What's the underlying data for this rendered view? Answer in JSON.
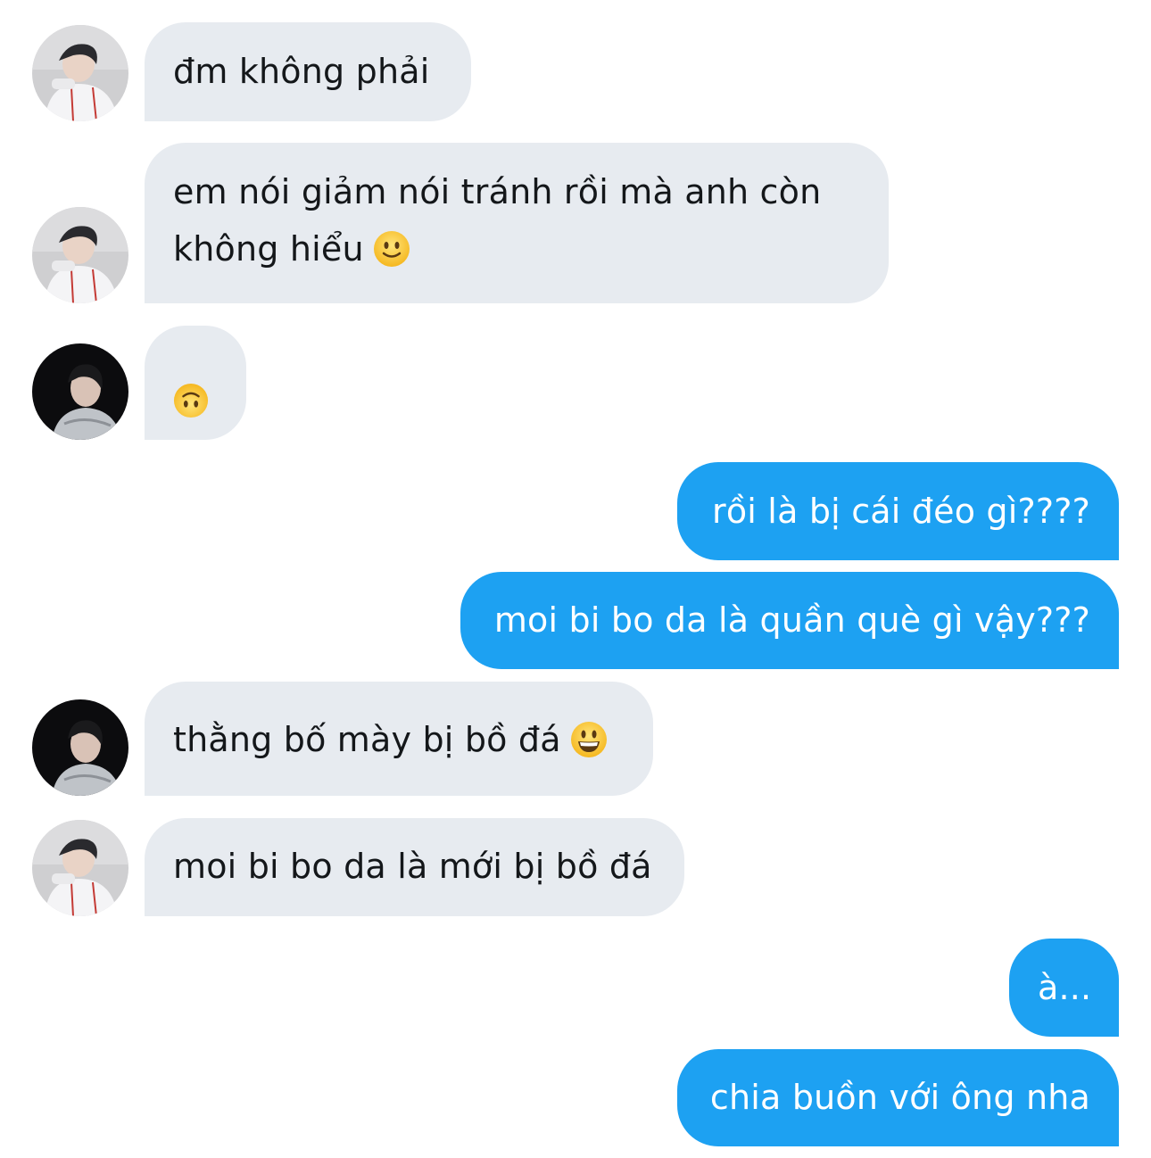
{
  "conversation": {
    "messages": [
      {
        "sender": "them",
        "avatar": "avatar-a",
        "text": "đm không phải",
        "emoji": ""
      },
      {
        "sender": "them",
        "avatar": "avatar-a",
        "text_line1": "em nói giảm nói tránh rồi mà anh còn",
        "text_line2": "không hiểu",
        "emoji": "slightly-smiling-face-icon"
      },
      {
        "sender": "them",
        "avatar": "avatar-b",
        "text": "",
        "emoji": "upside-down-face-icon"
      },
      {
        "sender": "me",
        "text": "rồi là bị cái đéo gì????"
      },
      {
        "sender": "me",
        "text": "moi bi bo da là quần què gì vậy???"
      },
      {
        "sender": "them",
        "avatar": "avatar-b",
        "text": "thằng bố mày bị bồ đá",
        "emoji": "grinning-face-icon"
      },
      {
        "sender": "them",
        "avatar": "avatar-a",
        "text": "moi bi bo da là mới bị bồ đá"
      },
      {
        "sender": "me",
        "text": "à..."
      },
      {
        "sender": "me",
        "text": "chia buồn với ông nha"
      }
    ]
  },
  "colors": {
    "incoming_bubble": "#e7ebf0",
    "incoming_text": "#14171a",
    "outgoing_bubble": "#1da1f2",
    "outgoing_text": "#ffffff"
  }
}
